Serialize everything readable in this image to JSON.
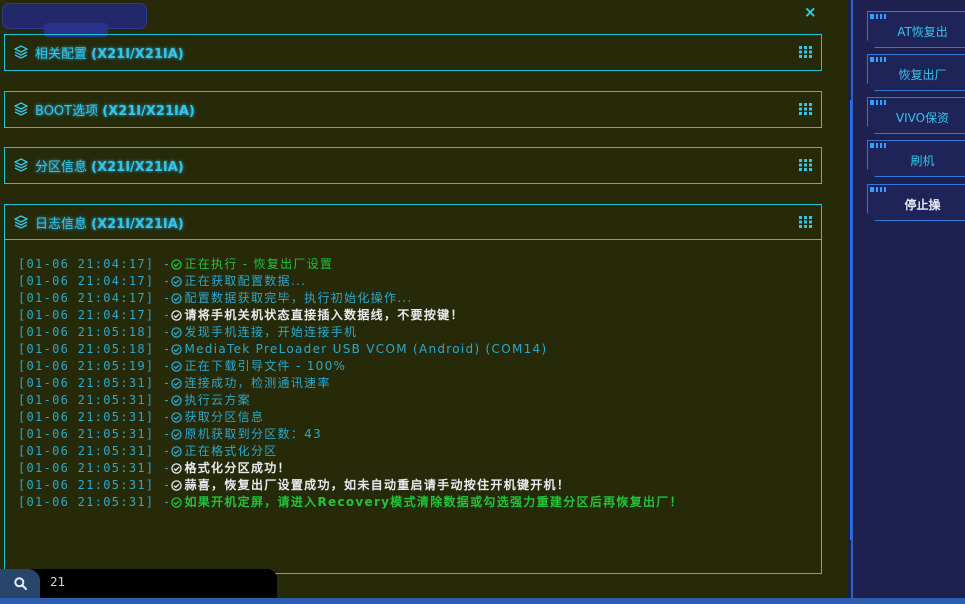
{
  "window": {
    "close_symbol": "×"
  },
  "panels": [
    {
      "title": "相关配置",
      "model": "(X21I/X21IA)"
    },
    {
      "title": "BOOT选项",
      "model": "(X21I/X21IA)"
    },
    {
      "title": "分区信息",
      "model": "(X21I/X21IA)"
    },
    {
      "title": "日志信息",
      "model": "(X21I/X21IA)"
    }
  ],
  "log": [
    {
      "time": "[01-06 21:04:17] - ",
      "text": "正在执行 - 恢复出厂设置",
      "color": "#22c23a",
      "bold": false
    },
    {
      "time": "[01-06 21:04:17] - ",
      "text": "正在获取配置数据...",
      "color": "#2aa8cf",
      "bold": false
    },
    {
      "time": "[01-06 21:04:17] - ",
      "text": "配置数据获取完毕，执行初始化操作...",
      "color": "#2aa8cf",
      "bold": false
    },
    {
      "time": "[01-06 21:04:17] - ",
      "text": "请将手机关机状态直接插入数据线，不要按键！",
      "color": "#e8eaf0",
      "bold": true
    },
    {
      "time": "[01-06 21:05:18] - ",
      "text": "发现手机连接，开始连接手机",
      "color": "#2aa8cf",
      "bold": false
    },
    {
      "time": "[01-06 21:05:18] - ",
      "text": "MediaTek PreLoader USB VCOM (Android) (COM14)",
      "color": "#2aa8cf",
      "bold": false
    },
    {
      "time": "[01-06 21:05:19] - ",
      "text": "正在下载引导文件 - 100%",
      "color": "#2aa8cf",
      "bold": false
    },
    {
      "time": "[01-06 21:05:31] - ",
      "text": "连接成功，检测通讯速率",
      "color": "#2aa8cf",
      "bold": false
    },
    {
      "time": "[01-06 21:05:31] - ",
      "text": "执行云方案",
      "color": "#2aa8cf",
      "bold": false
    },
    {
      "time": "[01-06 21:05:31] - ",
      "text": "获取分区信息",
      "color": "#2aa8cf",
      "bold": false
    },
    {
      "time": "[01-06 21:05:31] - ",
      "text": "原机获取到分区数：43",
      "color": "#2aa8cf",
      "bold": false
    },
    {
      "time": "[01-06 21:05:31] - ",
      "text": "正在格式化分区",
      "color": "#2aa8cf",
      "bold": false
    },
    {
      "time": "[01-06 21:05:31] - ",
      "text": "格式化分区成功！",
      "color": "#e8eaf0",
      "bold": true
    },
    {
      "time": "[01-06 21:05:31] - ",
      "text": "蒜喜，恢复出厂设置成功，如未自动重启请手动按住开机键开机！",
      "color": "#e8eaf0",
      "bold": true
    },
    {
      "time": "[01-06 21:05:31] - ",
      "text": "如果开机定屏，请进入Recovery模式清除数据或勾选强力重建分区后再恢复出厂！",
      "color": "#22c23a",
      "bold": true
    }
  ],
  "search": {
    "value": "21"
  },
  "side_buttons": [
    {
      "label": "AT恢复出"
    },
    {
      "label": "恢复出厂"
    },
    {
      "label": "VIVO保资"
    },
    {
      "label": "刷机"
    },
    {
      "label": "停止操"
    }
  ],
  "icons": {
    "panel": "layers-icon",
    "grid": "grid-icon",
    "check": "check-circle-icon",
    "search": "search-icon",
    "close": "close-icon"
  },
  "colors": {
    "accent": "#1ec3d9",
    "main_bg": "#262a08",
    "side_bg": "#1e2150",
    "timestamp": "#2aa8cf",
    "success": "#22c23a"
  }
}
